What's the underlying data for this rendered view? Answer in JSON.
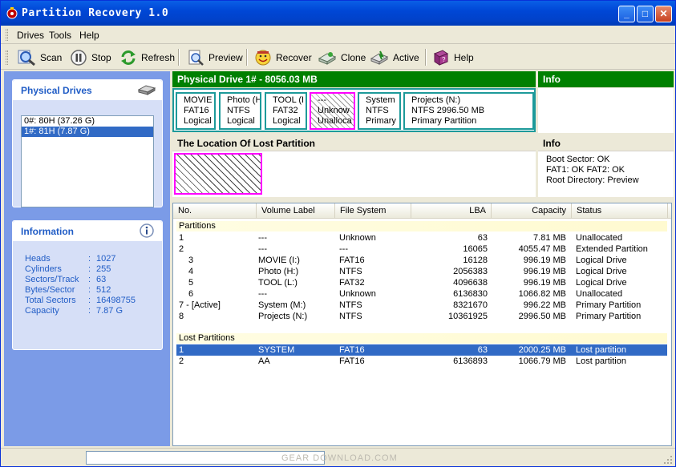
{
  "window": {
    "title": "Partition Recovery 1.0"
  },
  "menu": {
    "drives": "Drives",
    "tools": "Tools",
    "help": "Help"
  },
  "toolbar": {
    "scan": "Scan",
    "stop": "Stop",
    "refresh": "Refresh",
    "preview": "Preview",
    "recover": "Recover",
    "clone": "Clone",
    "active": "Active",
    "help": "Help"
  },
  "physical_drives": {
    "title": "Physical Drives",
    "items": [
      {
        "label": "0#: 80H (37.26 G)",
        "selected": false
      },
      {
        "label": "1#: 81H (7.87 G)",
        "selected": true
      }
    ]
  },
  "information": {
    "title": "Information",
    "rows": [
      {
        "key": "Heads",
        "value": "1027"
      },
      {
        "key": "Cylinders",
        "value": "255"
      },
      {
        "key": "Sectors/Track",
        "value": "63"
      },
      {
        "key": "Bytes/Sector",
        "value": "512"
      },
      {
        "key": "Total Sectors",
        "value": "16498755"
      },
      {
        "key": "Capacity",
        "value": "7.87 G"
      }
    ]
  },
  "drive_header": "Physical Drive 1# - 8056.03 MB",
  "info_header": "Info",
  "partitions_bar": [
    {
      "l1": "MOVIE",
      "l2": "FAT16",
      "l3": "Logical"
    },
    {
      "l1": "Photo (H",
      "l2": "NTFS",
      "l3": "Logical"
    },
    {
      "l1": "TOOL (I",
      "l2": "FAT32",
      "l3": "Logical"
    },
    {
      "l1": "---",
      "l2": "Unknow",
      "l3": "Unalloca"
    },
    {
      "l1": "System",
      "l2": "NTFS",
      "l3": "Primary"
    },
    {
      "l1": "Projects (N:)",
      "l2": "NTFS    2996.50 MB",
      "l3": "Primary Partition"
    }
  ],
  "lost_location_header": "The Location Of Lost Partition",
  "info2": {
    "header": "Info",
    "lines": [
      "Boot Sector: OK",
      "FAT1: OK   FAT2: OK",
      "Root Directory: Preview"
    ]
  },
  "table": {
    "columns": [
      "No.",
      "Volume Label",
      "File System",
      "LBA",
      "Capacity",
      "Status"
    ],
    "partitions_group": "Partitions",
    "partitions": [
      {
        "no": "1",
        "label": "---",
        "fs": "Unknown",
        "lba": "63",
        "cap": "7.81 MB",
        "status": "Unallocated"
      },
      {
        "no": "2",
        "label": "---",
        "fs": "---",
        "lba": "16065",
        "cap": "4055.47 MB",
        "status": "Extended Partition"
      },
      {
        "no": "3",
        "label": "MOVIE (I:)",
        "fs": "FAT16",
        "lba": "16128",
        "cap": "996.19 MB",
        "status": "Logical Drive"
      },
      {
        "no": "4",
        "label": "Photo (H:)",
        "fs": "NTFS",
        "lba": "2056383",
        "cap": "996.19 MB",
        "status": "Logical Drive"
      },
      {
        "no": "5",
        "label": "TOOL (L:)",
        "fs": "FAT32",
        "lba": "4096638",
        "cap": "996.19 MB",
        "status": "Logical Drive"
      },
      {
        "no": "6",
        "label": "---",
        "fs": "Unknown",
        "lba": "6136830",
        "cap": "1066.82 MB",
        "status": "Unallocated"
      },
      {
        "no": "7 - [Active]",
        "label": "System (M:)",
        "fs": "NTFS",
        "lba": "8321670",
        "cap": "996.22 MB",
        "status": "Primary Partition"
      },
      {
        "no": "8",
        "label": "Projects (N:)",
        "fs": "NTFS",
        "lba": "10361925",
        "cap": "2996.50 MB",
        "status": "Primary Partition"
      }
    ],
    "lost_group": "Lost Partitions",
    "lost": [
      {
        "no": "1",
        "label": "SYSTEM",
        "fs": "FAT16",
        "lba": "63",
        "cap": "2000.25 MB",
        "status": "Lost partition",
        "selected": true
      },
      {
        "no": "2",
        "label": "AA",
        "fs": "FAT16",
        "lba": "6136893",
        "cap": "1066.79 MB",
        "status": "Lost partition",
        "selected": false
      }
    ]
  },
  "statusbar": {
    "watermark": "GEAR DOWNLOAD.COM"
  },
  "colors": {
    "title_blue": "#0047d6",
    "accent_green": "#008000",
    "selection": "#316ac5",
    "teal_border": "#1d9a9a",
    "magenta": "#ff00ff"
  }
}
